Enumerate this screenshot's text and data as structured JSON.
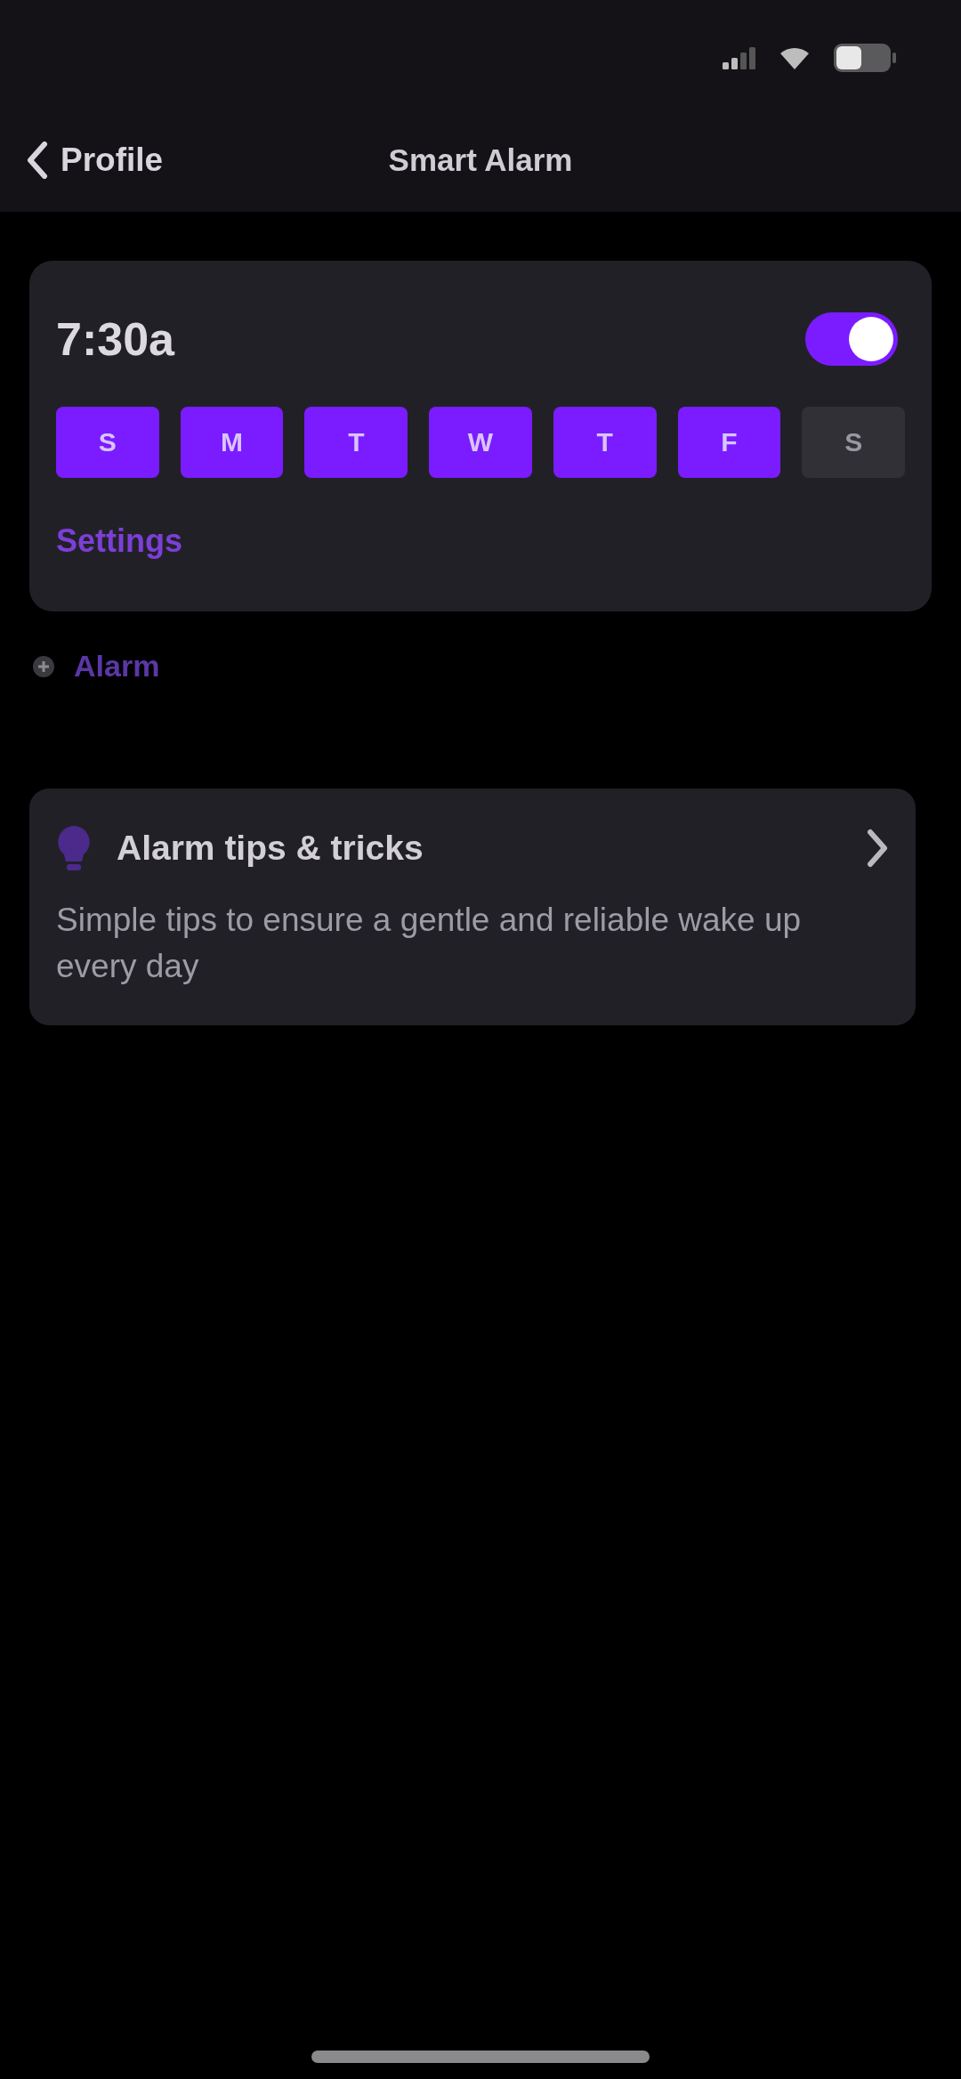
{
  "nav": {
    "back_label": "Profile",
    "title": "Smart Alarm"
  },
  "alarm": {
    "time": "7:30a",
    "on": true,
    "days": [
      {
        "label": "S",
        "selected": true
      },
      {
        "label": "M",
        "selected": true
      },
      {
        "label": "T",
        "selected": true
      },
      {
        "label": "W",
        "selected": true
      },
      {
        "label": "T",
        "selected": true
      },
      {
        "label": "F",
        "selected": true
      },
      {
        "label": "S",
        "selected": false
      }
    ],
    "settings_link": "Settings"
  },
  "add_alarm": {
    "label": "Alarm"
  },
  "tips_card": {
    "title": "Alarm tips & tricks",
    "description": "Simple tips to ensure a gentle and reliable wake up every day"
  }
}
